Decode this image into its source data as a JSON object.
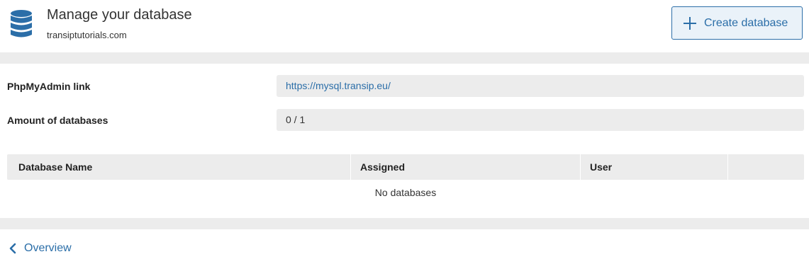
{
  "header": {
    "title": "Manage your database",
    "domain": "transiptutorials.com",
    "create_button_label": "Create database",
    "icon": "database-icon"
  },
  "info": {
    "phpmyadmin_label": "PhpMyAdmin link",
    "phpmyadmin_url": "https://mysql.transip.eu/",
    "amount_label": "Amount of databases",
    "amount_value": "0 / 1"
  },
  "table": {
    "columns": [
      "Database Name",
      "Assigned",
      "User",
      ""
    ],
    "empty_message": "No databases"
  },
  "footer": {
    "back_label": "Overview",
    "icon": "chevron-left-icon"
  },
  "colors": {
    "accent": "#2b6ea8",
    "band": "#ececec",
    "button_bg": "#eaf2f9"
  }
}
